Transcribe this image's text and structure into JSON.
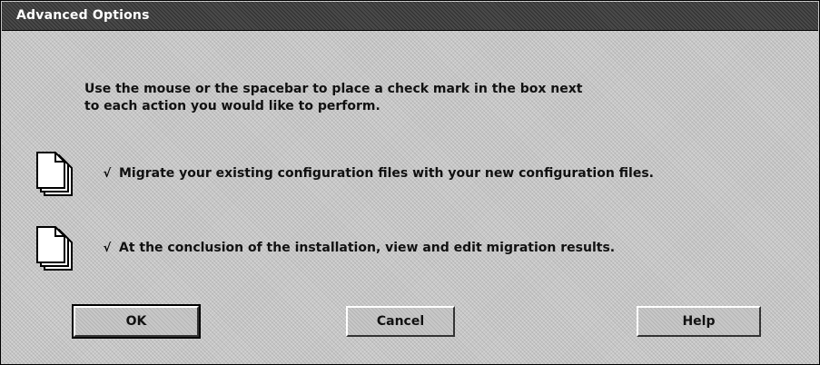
{
  "window": {
    "title": "Advanced Options"
  },
  "instructions": {
    "line1": "Use the mouse or the spacebar to place a check mark in the box next",
    "line2": "to each action you would like to perform."
  },
  "options": [
    {
      "checked": true,
      "check_glyph": "√",
      "label": "Migrate your existing configuration files with your new configuration files.",
      "icon": "document-icon"
    },
    {
      "checked": true,
      "check_glyph": "√",
      "label": "At the conclusion of the installation,  view and edit migration results.",
      "icon": "document-icon"
    }
  ],
  "buttons": {
    "ok": "OK",
    "cancel": "Cancel",
    "help": "Help"
  }
}
